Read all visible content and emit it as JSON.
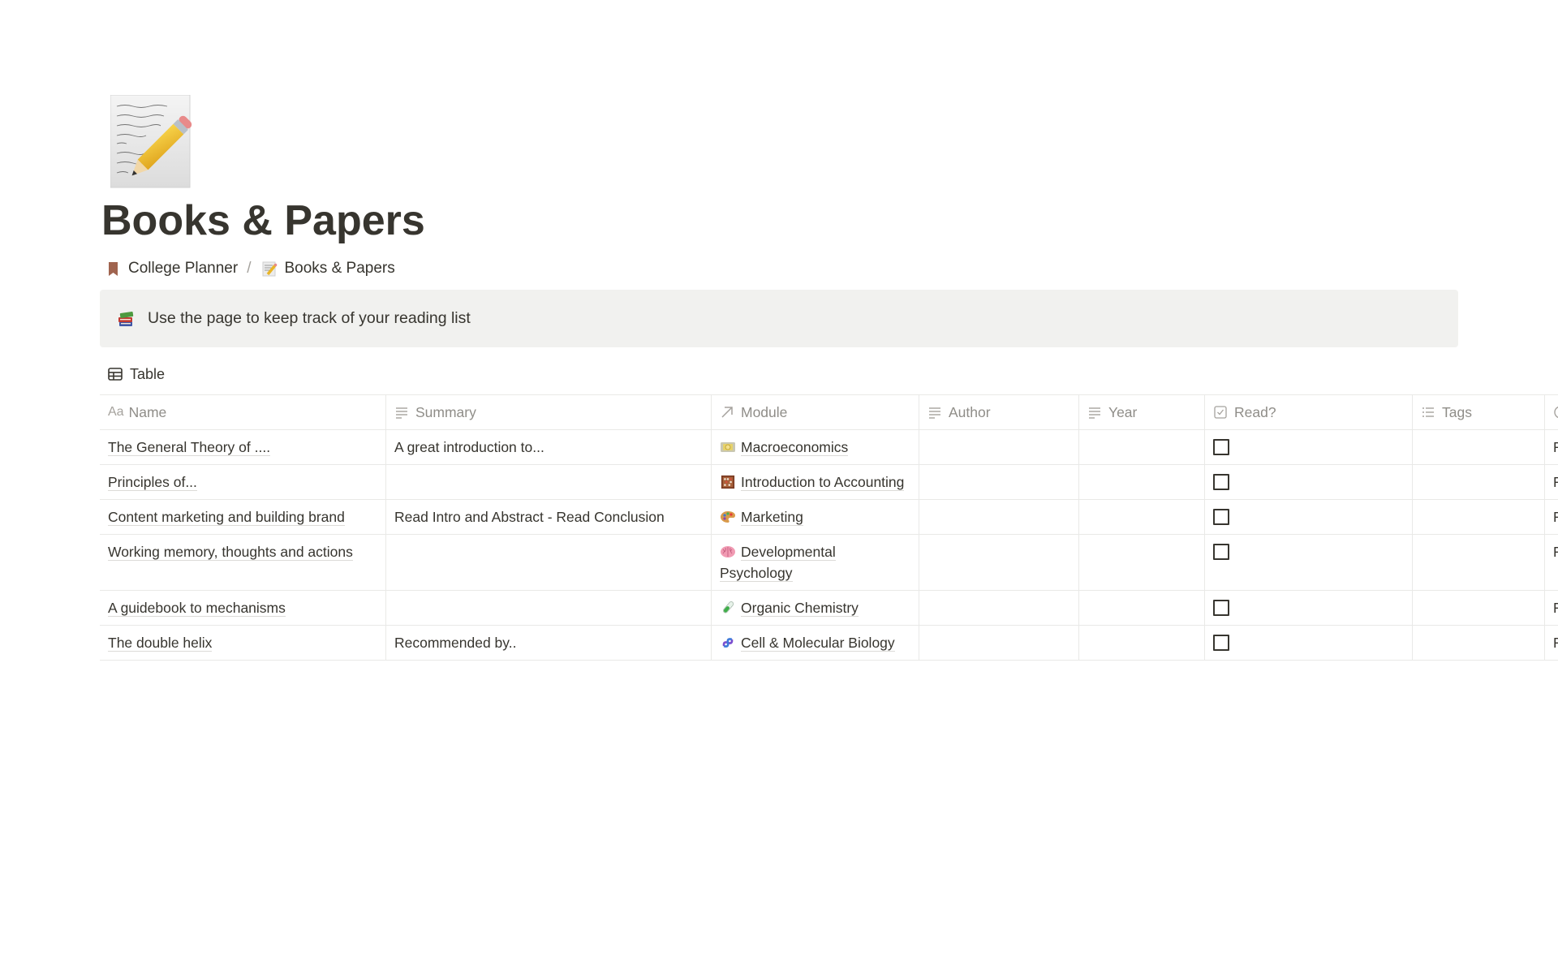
{
  "page": {
    "icon": "memo-icon",
    "title": "Books & Papers"
  },
  "breadcrumb": [
    {
      "icon": "bookmark-icon",
      "label": "College Planner"
    },
    {
      "icon": "memo-icon",
      "label": "Books & Papers"
    }
  ],
  "breadcrumb_separator": "/",
  "callout": {
    "icon": "books-icon",
    "text": "Use the page to keep track of your reading list"
  },
  "view": {
    "icon": "table-icon",
    "label": "Table"
  },
  "table": {
    "columns": [
      {
        "key": "name",
        "label": "Name",
        "icon": "title-aa-icon"
      },
      {
        "key": "summary",
        "label": "Summary",
        "icon": "text-lines-icon"
      },
      {
        "key": "module",
        "label": "Module",
        "icon": "relation-arrow-icon"
      },
      {
        "key": "author",
        "label": "Author",
        "icon": "text-lines-icon"
      },
      {
        "key": "year",
        "label": "Year",
        "icon": "text-lines-icon"
      },
      {
        "key": "read",
        "label": "Read?",
        "icon": "checkbox-icon"
      },
      {
        "key": "tags",
        "label": "Tags",
        "icon": "list-icon"
      },
      {
        "key": "last",
        "label": "",
        "icon": "clock-icon"
      }
    ],
    "aa_glyph": "Aa",
    "rows": [
      {
        "name": "The General Theory of ....",
        "summary": "A great introduction to...",
        "module": {
          "icon": "money-icon",
          "label": "Macroeconomics"
        },
        "author": "",
        "year": "",
        "read": false,
        "tags": "",
        "last": "F"
      },
      {
        "name": "Principles of...",
        "summary": "",
        "module": {
          "icon": "abacus-icon",
          "label": "Introduction to Accounting"
        },
        "author": "",
        "year": "",
        "read": false,
        "tags": "",
        "last": "F"
      },
      {
        "name": "Content marketing and building brand",
        "summary": "Read Intro and Abstract - Read Conclusion",
        "module": {
          "icon": "palette-icon",
          "label": "Marketing"
        },
        "author": "",
        "year": "",
        "read": false,
        "tags": "",
        "last": "F"
      },
      {
        "name": "Working memory, thoughts and actions",
        "summary": "",
        "module": {
          "icon": "brain-icon",
          "label": "Developmental Psychology"
        },
        "author": "",
        "year": "",
        "read": false,
        "tags": "",
        "last": "F"
      },
      {
        "name": "A guidebook to mechanisms",
        "summary": "",
        "module": {
          "icon": "test-tube-icon",
          "label": "Organic Chemistry"
        },
        "author": "",
        "year": "",
        "read": false,
        "tags": "",
        "last": "F"
      },
      {
        "name": "The double helix",
        "summary": "Recommended by..",
        "module": {
          "icon": "dna-icon",
          "label": "Cell & Molecular Biology"
        },
        "author": "",
        "year": "",
        "read": false,
        "tags": "",
        "last": "F"
      }
    ]
  },
  "colors": {
    "text": "#37352f",
    "muted": "#8f8d88",
    "callout_bg": "#f1f1ef",
    "border": "#e9e9e7",
    "bookmark": "#a0644f"
  }
}
